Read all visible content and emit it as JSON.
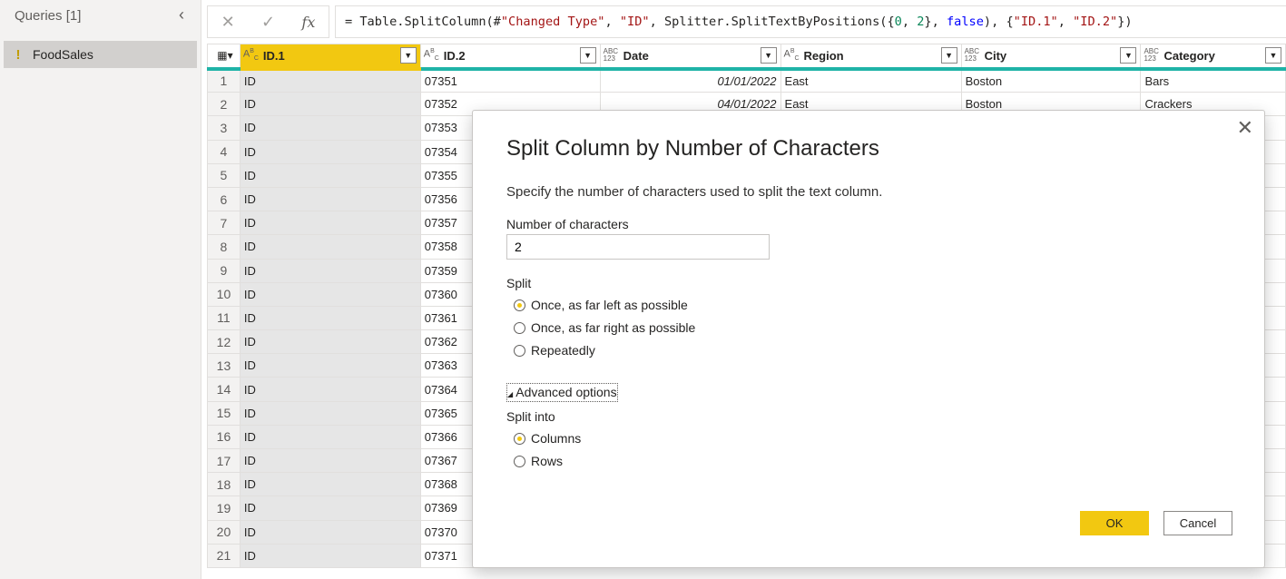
{
  "queries": {
    "title": "Queries [1]",
    "collapse_icon": "chevron-left-icon",
    "items": [
      {
        "label": "FoodSales",
        "icon": "warning-icon"
      }
    ]
  },
  "formula": {
    "cancel_icon": "x-icon",
    "commit_icon": "check-icon",
    "fx_label": "fx",
    "p1": "= Table.SplitColumn(#",
    "s1": "\"Changed Type\"",
    "p2": ", ",
    "s2": "\"ID\"",
    "p3": ", Splitter.SplitTextByPositions({",
    "n1": "0",
    "p4": ", ",
    "n2": "2",
    "p5": "}, ",
    "kw": "false",
    "p6": "), {",
    "s3": "\"ID.1\"",
    "p7": ", ",
    "s4": "\"ID.2\"",
    "p8": "})"
  },
  "grid": {
    "columns": [
      {
        "name": "ID.1",
        "type": "text",
        "type_label": "ABC"
      },
      {
        "name": "ID.2",
        "type": "text",
        "type_label": "ABC"
      },
      {
        "name": "Date",
        "type": "any",
        "type_label": "ABC 123"
      },
      {
        "name": "Region",
        "type": "text",
        "type_label": "ABC"
      },
      {
        "name": "City",
        "type": "any",
        "type_label": "ABC 123"
      },
      {
        "name": "Category",
        "type": "any",
        "type_label": "ABC 123"
      }
    ],
    "rows": [
      [
        "1",
        "ID",
        "07351",
        "01/01/2022",
        "East",
        "Boston",
        "Bars"
      ],
      [
        "2",
        "ID",
        "07352",
        "04/01/2022",
        "East",
        "Boston",
        "Crackers"
      ],
      [
        "3",
        "ID",
        "07353",
        "",
        "",
        "",
        ""
      ],
      [
        "4",
        "ID",
        "07354",
        "",
        "",
        "",
        ""
      ],
      [
        "5",
        "ID",
        "07355",
        "",
        "",
        "",
        ""
      ],
      [
        "6",
        "ID",
        "07356",
        "",
        "",
        "",
        ""
      ],
      [
        "7",
        "ID",
        "07357",
        "",
        "",
        "",
        ""
      ],
      [
        "8",
        "ID",
        "07358",
        "",
        "",
        "",
        ""
      ],
      [
        "9",
        "ID",
        "07359",
        "",
        "",
        "",
        ""
      ],
      [
        "10",
        "ID",
        "07360",
        "",
        "",
        "",
        ""
      ],
      [
        "11",
        "ID",
        "07361",
        "",
        "",
        "",
        ""
      ],
      [
        "12",
        "ID",
        "07362",
        "",
        "",
        "",
        ""
      ],
      [
        "13",
        "ID",
        "07363",
        "",
        "",
        "",
        ""
      ],
      [
        "14",
        "ID",
        "07364",
        "",
        "",
        "",
        ""
      ],
      [
        "15",
        "ID",
        "07365",
        "",
        "",
        "",
        ""
      ],
      [
        "16",
        "ID",
        "07366",
        "",
        "",
        "",
        ""
      ],
      [
        "17",
        "ID",
        "07367",
        "",
        "",
        "",
        ""
      ],
      [
        "18",
        "ID",
        "07368",
        "",
        "",
        "",
        ""
      ],
      [
        "19",
        "ID",
        "07369",
        "",
        "",
        "",
        ""
      ],
      [
        "20",
        "ID",
        "07370",
        "",
        "",
        "",
        ""
      ],
      [
        "21",
        "ID",
        "07371",
        "",
        "",
        "",
        ""
      ]
    ]
  },
  "dialog": {
    "title": "Split Column by Number of Characters",
    "description": "Specify the number of characters used to split the text column.",
    "num_chars_label": "Number of characters",
    "num_chars_value": "2",
    "split_label": "Split",
    "split_options": [
      {
        "label": "Once, as far left as possible",
        "selected": true
      },
      {
        "label": "Once, as far right as possible",
        "selected": false
      },
      {
        "label": "Repeatedly",
        "selected": false
      }
    ],
    "advanced_label": "Advanced options",
    "split_into_label": "Split into",
    "split_into_options": [
      {
        "label": "Columns",
        "selected": true
      },
      {
        "label": "Rows",
        "selected": false
      }
    ],
    "ok_label": "OK",
    "cancel_label": "Cancel",
    "close_icon": "close-icon"
  },
  "colors": {
    "accent": "#f2c811",
    "column_quality": "#1fb3a7"
  }
}
